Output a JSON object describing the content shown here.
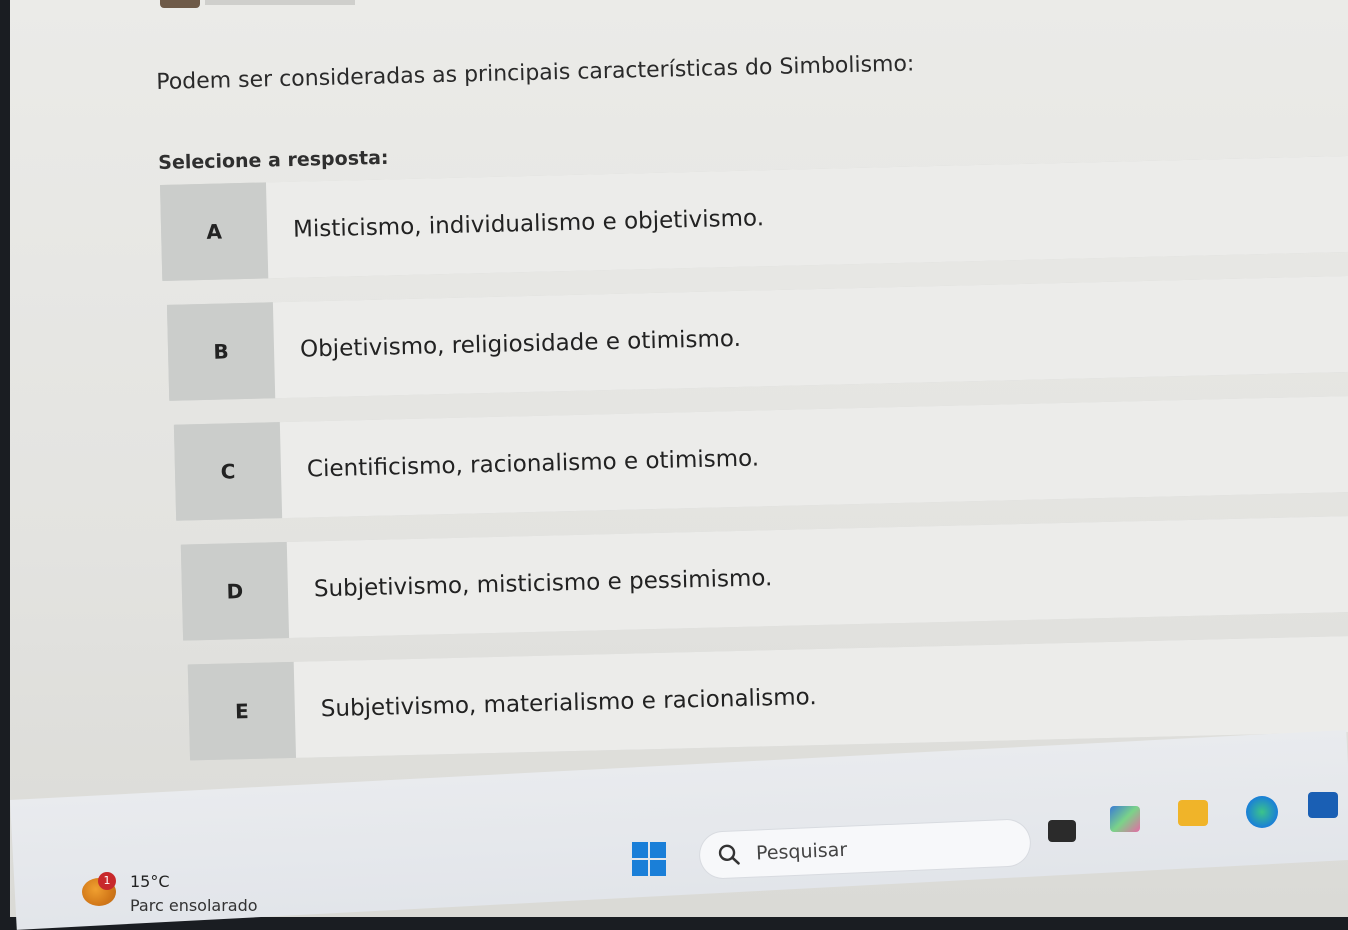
{
  "question": {
    "text": "Podem ser consideradas as principais características do Simbolismo:",
    "prompt": "Selecione a resposta:"
  },
  "options": [
    {
      "letter": "A",
      "text": "Misticismo, individualismo e objetivismo."
    },
    {
      "letter": "B",
      "text": "Objetivismo, religiosidade e otimismo."
    },
    {
      "letter": "C",
      "text": "Cientificismo, racionalismo e otimismo."
    },
    {
      "letter": "D",
      "text": "Subjetivismo, misticismo e pessimismo."
    },
    {
      "letter": "E",
      "text": "Subjetivismo, materialismo e racionalismo."
    }
  ],
  "taskbar": {
    "weather": {
      "badge": "1",
      "temperature": "15°C",
      "condition": "Parc ensolarado"
    },
    "search_placeholder": "Pesquisar",
    "icons": [
      "windows-start-icon",
      "search-icon",
      "file-explorer-icon",
      "copilot-icon",
      "folder-icon",
      "edge-icon",
      "store-icon"
    ]
  },
  "colors": {
    "accent": "#1a7fd8",
    "option_letter_bg": "#cbcdcb",
    "option_text_bg": "#ececea"
  }
}
